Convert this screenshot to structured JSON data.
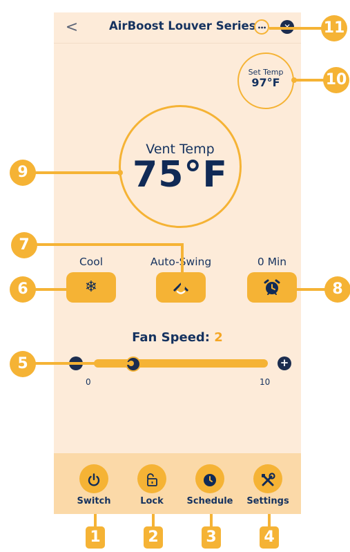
{
  "header": {
    "back_glyph": "<",
    "title": "AirBoost Louver Series",
    "more_glyph": "•••",
    "close_glyph": "✕"
  },
  "set_temp": {
    "label": "Set Temp",
    "value": "97°F"
  },
  "vent_temp": {
    "label": "Vent Temp",
    "value": "75°F"
  },
  "controls": [
    {
      "label": "Cool",
      "icon": "snowflake-icon",
      "glyph": "❄"
    },
    {
      "label": "Auto-Swing",
      "icon": "swing-icon",
      "glyph": "◇"
    },
    {
      "label": "0 Min",
      "icon": "alarm-clock-icon",
      "glyph": "⏰"
    }
  ],
  "fan": {
    "label": "Fan Speed:",
    "value": "2",
    "min": "0",
    "max": "10",
    "minus_glyph": "−",
    "plus_glyph": "+",
    "level": 2
  },
  "nav": [
    {
      "label": "Switch",
      "icon": "power-icon",
      "glyph": "⏻"
    },
    {
      "label": "Lock",
      "icon": "lock-icon",
      "glyph": "🔓"
    },
    {
      "label": "Schedule",
      "icon": "clock-icon",
      "glyph": "◷"
    },
    {
      "label": "Settings",
      "icon": "tools-icon",
      "glyph": "✖"
    }
  ],
  "callouts": [
    "1",
    "2",
    "3",
    "4",
    "5",
    "6",
    "7",
    "8",
    "9",
    "10",
    "11"
  ],
  "colors": {
    "accent": "#f5b335",
    "background": "#fdebd9",
    "navy": "#102a56",
    "bottom_bar": "#fbd9a8"
  }
}
